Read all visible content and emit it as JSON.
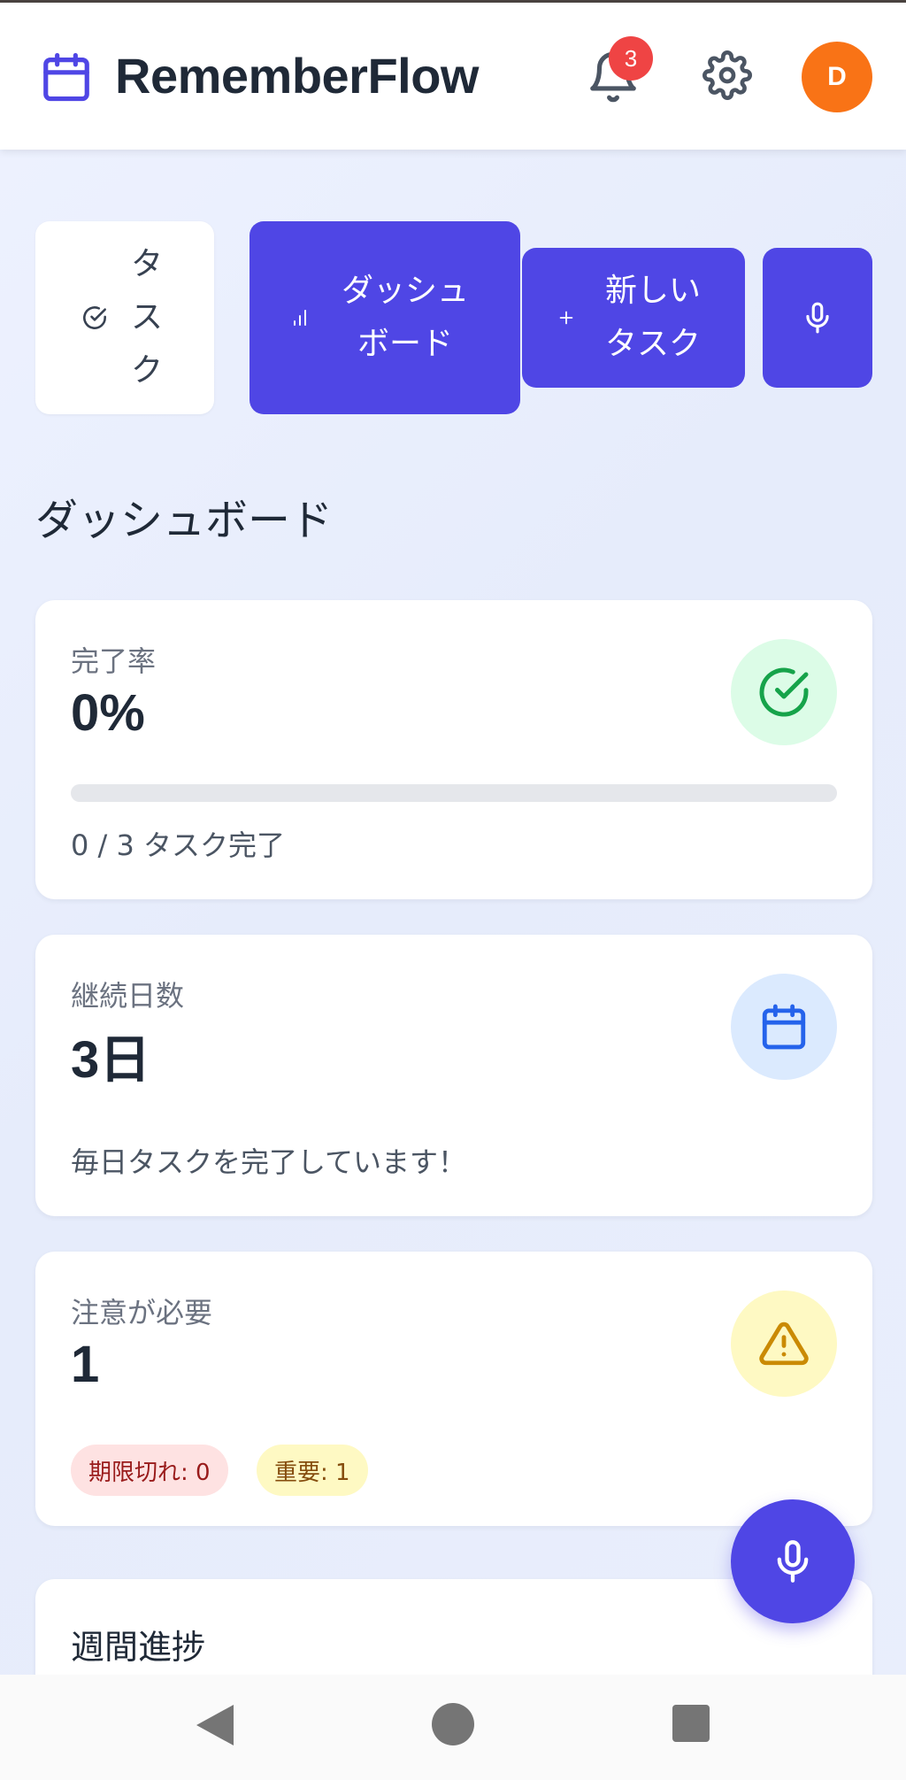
{
  "header": {
    "app_name": "RememberFlow",
    "notification_count": "3",
    "avatar_initial": "D",
    "icons": [
      "calendar-icon",
      "bell-icon",
      "gear-icon"
    ]
  },
  "nav": {
    "tasks_label": "タスク",
    "dashboard_label": "ダッシュボード",
    "new_task_label": "新しいタスク",
    "icons": [
      "check-circle-icon",
      "bar-chart-icon",
      "plus-icon",
      "microphone-icon"
    ]
  },
  "section_title": "ダッシュボード",
  "completion": {
    "label": "完了率",
    "value": "0%",
    "progress_fraction": 0,
    "summary": "0 / 3 タスク完了"
  },
  "streak": {
    "label": "継続日数",
    "value": "3日",
    "message": "毎日タスクを完了しています！"
  },
  "attention": {
    "label": "注意が必要",
    "value": "1",
    "overdue": "期限切れ: 0",
    "important": "重要: 1"
  },
  "weekly": {
    "title": "週間進捗"
  },
  "colors": {
    "accent": "#4f46e5",
    "success": "#16a34a",
    "info": "#2563eb",
    "warning": "#ca8a04",
    "avatar": "#f97316",
    "badge": "#ef4444"
  }
}
